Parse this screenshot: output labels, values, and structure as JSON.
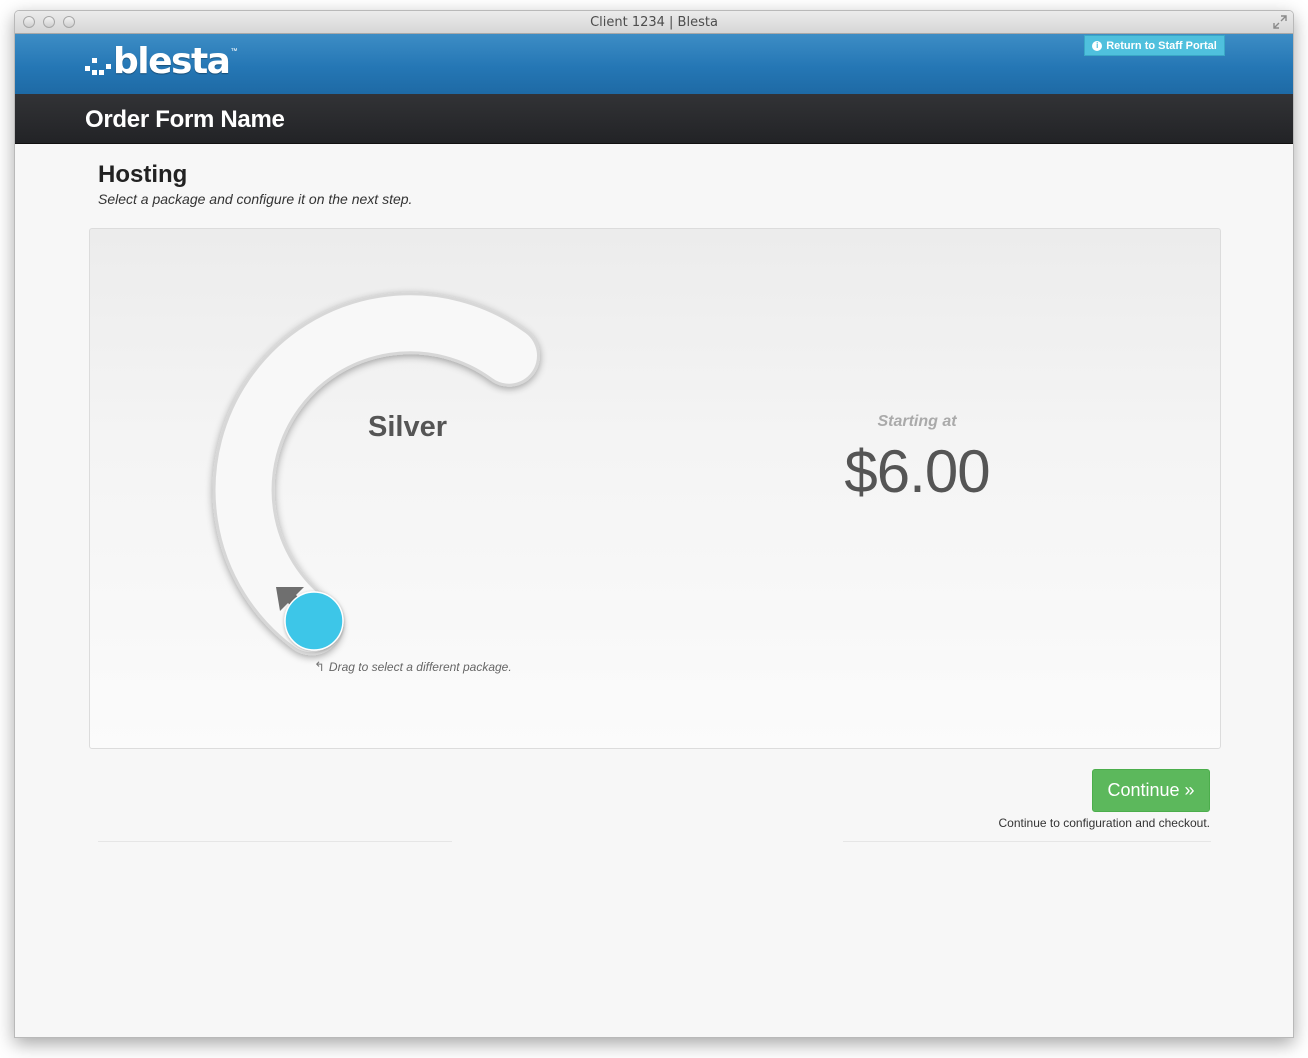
{
  "window": {
    "title": "Client 1234 | Blesta"
  },
  "header": {
    "logo_text": "blesta",
    "logo_tm": "™",
    "staff_portal_label": "Return to Staff Portal",
    "info_icon_glyph": "i"
  },
  "nav": {
    "page_title": "Order Form Name"
  },
  "section": {
    "title": "Hosting",
    "subtitle": "Select a package and configure it on the next step."
  },
  "package": {
    "selected_name": "Silver",
    "drag_hint": "Drag to select a different package.",
    "drag_hint_arrow": "↰",
    "price_label": "Starting at",
    "price": "$6.00"
  },
  "actions": {
    "continue_label": "Continue »",
    "continue_note": "Continue to configuration and checkout."
  },
  "colors": {
    "header_blue": "#2577b5",
    "navbar_dark": "#2a2b2e",
    "accent_cyan": "#3ec6e8",
    "continue_green": "#5cb85c"
  },
  "icons": [
    "info-icon",
    "drag-arrow-icon",
    "fullscreen-icon",
    "slider-handle"
  ]
}
